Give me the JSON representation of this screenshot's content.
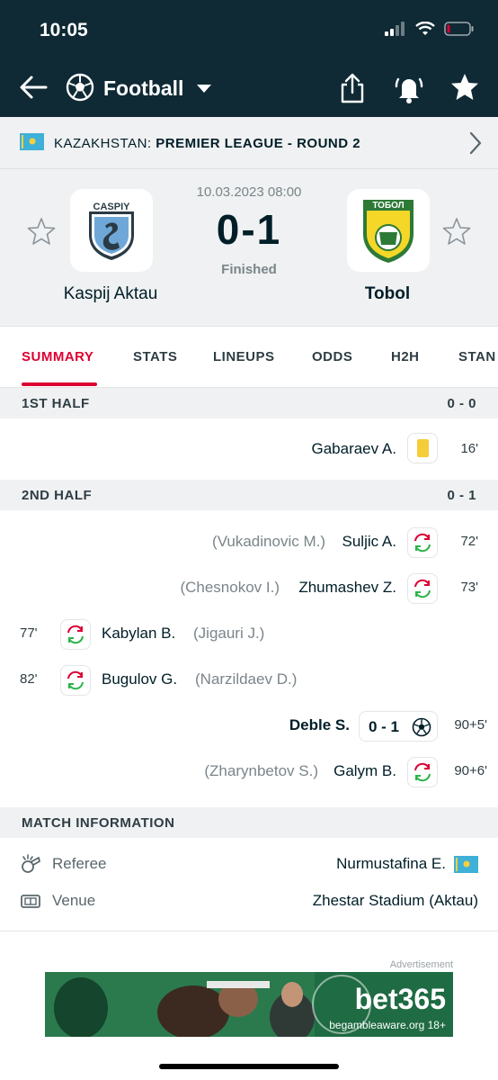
{
  "status_bar": {
    "time": "10:05"
  },
  "nav": {
    "title": "Football"
  },
  "league": {
    "country": "KAZAKHSTAN:",
    "name": "PREMIER LEAGUE - ROUND 2"
  },
  "match": {
    "date": "10.03.2023 08:00",
    "score": "0-1",
    "status": "Finished",
    "home_team": "Kaspij Aktau",
    "away_team": "Tobol",
    "home_logo_text": "CASPIY",
    "away_logo_text": "ТОБОЛ"
  },
  "tabs": [
    "SUMMARY",
    "STATS",
    "LINEUPS",
    "ODDS",
    "H2H",
    "STAN"
  ],
  "first_half": {
    "label": "1ST HALF",
    "score": "0 - 0"
  },
  "events_1": [
    {
      "side": "away",
      "type": "yellow-card",
      "player": "Gabaraev A.",
      "minute": "16'"
    }
  ],
  "second_half": {
    "label": "2ND HALF",
    "score": "0 - 1"
  },
  "events_2": [
    {
      "side": "away",
      "type": "substitution",
      "player": "Suljic A.",
      "sub": "(Vukadinovic M.)",
      "minute": "72'"
    },
    {
      "side": "away",
      "type": "substitution",
      "player": "Zhumashev Z.",
      "sub": "(Chesnokov I.)",
      "minute": "73'"
    },
    {
      "side": "home",
      "type": "substitution",
      "player": "Kabylan B.",
      "sub": "(Jigauri J.)",
      "minute": "77'"
    },
    {
      "side": "home",
      "type": "substitution",
      "player": "Bugulov G.",
      "sub": "(Narzildaev D.)",
      "minute": "82'"
    },
    {
      "side": "away",
      "type": "goal",
      "player": "Deble S.",
      "score": "0 - 1",
      "minute": "90+5'"
    },
    {
      "side": "away",
      "type": "substitution",
      "player": "Galym B.",
      "sub": "(Zharynbetov S.)",
      "minute": "90+6'"
    }
  ],
  "match_info": {
    "heading": "MATCH INFORMATION",
    "referee_label": "Referee",
    "referee_value": "Nurmustafina E.",
    "venue_label": "Venue",
    "venue_value": "Zhestar Stadium (Aktau)"
  },
  "ad": {
    "label": "Advertisement",
    "brand": "bet365",
    "tagline": "begambleaware.org 18+"
  },
  "colors": {
    "header": "#0f2a35",
    "accent": "#dc0032",
    "sub_green": "#2cb34a",
    "sub_red": "#dc0032",
    "yellow_card": "#f5cd3a"
  }
}
